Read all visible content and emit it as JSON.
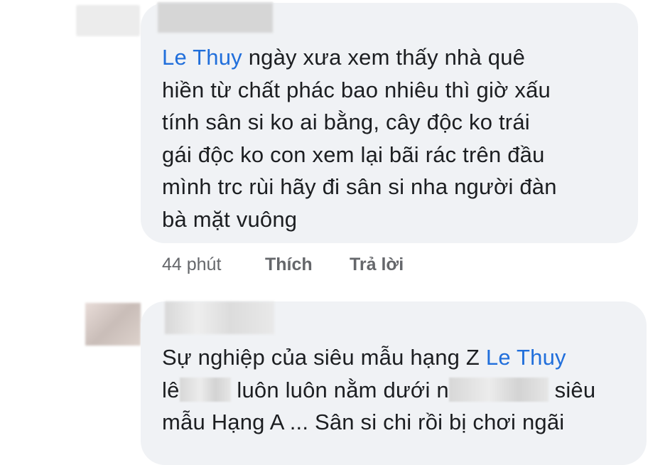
{
  "comments": [
    {
      "author": "",
      "mention": "Le Thuy",
      "lines": [
        "ngày xưa xem thấy nhà quê",
        "hiền từ chất phác bao nhiêu thì giờ xấu",
        "tính sân si ko ai bằng, cây độc ko trái",
        "gái độc ko con xem lại bãi rác trên đầu",
        "mình trc rùi hãy đi sân si nha người đàn",
        "bà mặt vuông"
      ],
      "time": "44 phút",
      "like_label": "Thích",
      "reply_label": "Trả lời"
    },
    {
      "author": "",
      "line1_prefix": "Sự nghiệp của siêu mẫu hạng Z",
      "mention": "Le Thuy",
      "line2_start": "lê",
      "line2_mid": "luôn luôn nằm dưới",
      "line2_mid2": "n",
      "line2_end": "siêu",
      "line3": "mẫu Hạng A ... Sân si chi rồi bị chơi ngãi"
    }
  ],
  "colors": {
    "bubble": "#f0f2f5",
    "mention": "#216fdb",
    "meta": "#65676b",
    "text": "#1c1e21"
  }
}
